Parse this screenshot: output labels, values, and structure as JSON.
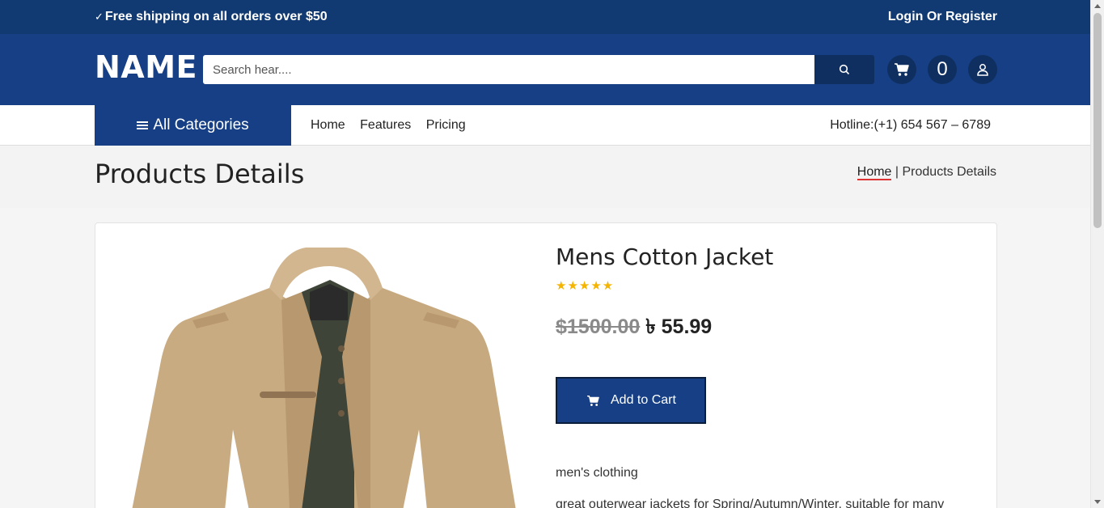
{
  "topbar": {
    "shipping": "Free shipping on all orders over $50",
    "login": "Login Or Register"
  },
  "header": {
    "logo": "NAME",
    "search_placeholder": "Search hear....",
    "cart_count": "0"
  },
  "nav": {
    "all_categories": "All Categories",
    "links": [
      "Home",
      "Features",
      "Pricing"
    ],
    "hotline": "Hotline:(+1) 654 567 – 6789"
  },
  "page": {
    "title": "Products Details",
    "breadcrumb": {
      "home": "Home",
      "separator": " | ",
      "current": "Products Details"
    }
  },
  "product": {
    "title": "Mens Cotton Jacket",
    "rating": 5,
    "stars": "★★★★★",
    "old_price": "$1500.00",
    "currency": "৳",
    "price": "55.99",
    "add_to_cart": "Add to Cart",
    "category": "men's clothing",
    "description": "great outerwear jackets for Spring/Autumn/Winter, suitable for many"
  },
  "colors": {
    "top_bar": "#123a72",
    "header": "#163f85",
    "dark_button": "#0f2f60",
    "star": "#f4b400",
    "breadcrumb_underline": "#d33333"
  },
  "icons": {
    "check": "check-icon",
    "search": "search-icon",
    "cart": "cart-icon",
    "user": "user-icon",
    "menu": "hamburger-icon"
  }
}
